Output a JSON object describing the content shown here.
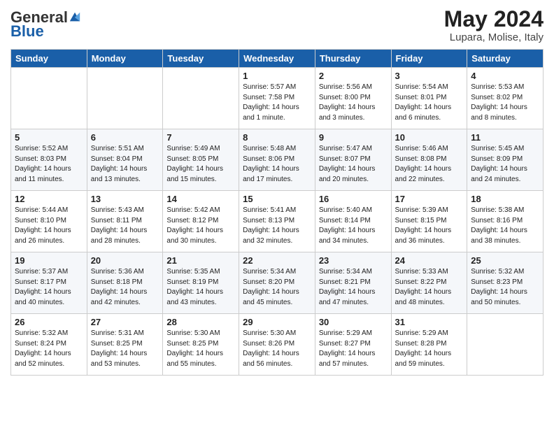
{
  "header": {
    "logo_general": "General",
    "logo_blue": "Blue",
    "month_title": "May 2024",
    "location": "Lupara, Molise, Italy"
  },
  "days_of_week": [
    "Sunday",
    "Monday",
    "Tuesday",
    "Wednesday",
    "Thursday",
    "Friday",
    "Saturday"
  ],
  "weeks": [
    [
      {
        "day": "",
        "content": ""
      },
      {
        "day": "",
        "content": ""
      },
      {
        "day": "",
        "content": ""
      },
      {
        "day": "1",
        "content": "Sunrise: 5:57 AM\nSunset: 7:58 PM\nDaylight: 14 hours\nand 1 minute."
      },
      {
        "day": "2",
        "content": "Sunrise: 5:56 AM\nSunset: 8:00 PM\nDaylight: 14 hours\nand 3 minutes."
      },
      {
        "day": "3",
        "content": "Sunrise: 5:54 AM\nSunset: 8:01 PM\nDaylight: 14 hours\nand 6 minutes."
      },
      {
        "day": "4",
        "content": "Sunrise: 5:53 AM\nSunset: 8:02 PM\nDaylight: 14 hours\nand 8 minutes."
      }
    ],
    [
      {
        "day": "5",
        "content": "Sunrise: 5:52 AM\nSunset: 8:03 PM\nDaylight: 14 hours\nand 11 minutes."
      },
      {
        "day": "6",
        "content": "Sunrise: 5:51 AM\nSunset: 8:04 PM\nDaylight: 14 hours\nand 13 minutes."
      },
      {
        "day": "7",
        "content": "Sunrise: 5:49 AM\nSunset: 8:05 PM\nDaylight: 14 hours\nand 15 minutes."
      },
      {
        "day": "8",
        "content": "Sunrise: 5:48 AM\nSunset: 8:06 PM\nDaylight: 14 hours\nand 17 minutes."
      },
      {
        "day": "9",
        "content": "Sunrise: 5:47 AM\nSunset: 8:07 PM\nDaylight: 14 hours\nand 20 minutes."
      },
      {
        "day": "10",
        "content": "Sunrise: 5:46 AM\nSunset: 8:08 PM\nDaylight: 14 hours\nand 22 minutes."
      },
      {
        "day": "11",
        "content": "Sunrise: 5:45 AM\nSunset: 8:09 PM\nDaylight: 14 hours\nand 24 minutes."
      }
    ],
    [
      {
        "day": "12",
        "content": "Sunrise: 5:44 AM\nSunset: 8:10 PM\nDaylight: 14 hours\nand 26 minutes."
      },
      {
        "day": "13",
        "content": "Sunrise: 5:43 AM\nSunset: 8:11 PM\nDaylight: 14 hours\nand 28 minutes."
      },
      {
        "day": "14",
        "content": "Sunrise: 5:42 AM\nSunset: 8:12 PM\nDaylight: 14 hours\nand 30 minutes."
      },
      {
        "day": "15",
        "content": "Sunrise: 5:41 AM\nSunset: 8:13 PM\nDaylight: 14 hours\nand 32 minutes."
      },
      {
        "day": "16",
        "content": "Sunrise: 5:40 AM\nSunset: 8:14 PM\nDaylight: 14 hours\nand 34 minutes."
      },
      {
        "day": "17",
        "content": "Sunrise: 5:39 AM\nSunset: 8:15 PM\nDaylight: 14 hours\nand 36 minutes."
      },
      {
        "day": "18",
        "content": "Sunrise: 5:38 AM\nSunset: 8:16 PM\nDaylight: 14 hours\nand 38 minutes."
      }
    ],
    [
      {
        "day": "19",
        "content": "Sunrise: 5:37 AM\nSunset: 8:17 PM\nDaylight: 14 hours\nand 40 minutes."
      },
      {
        "day": "20",
        "content": "Sunrise: 5:36 AM\nSunset: 8:18 PM\nDaylight: 14 hours\nand 42 minutes."
      },
      {
        "day": "21",
        "content": "Sunrise: 5:35 AM\nSunset: 8:19 PM\nDaylight: 14 hours\nand 43 minutes."
      },
      {
        "day": "22",
        "content": "Sunrise: 5:34 AM\nSunset: 8:20 PM\nDaylight: 14 hours\nand 45 minutes."
      },
      {
        "day": "23",
        "content": "Sunrise: 5:34 AM\nSunset: 8:21 PM\nDaylight: 14 hours\nand 47 minutes."
      },
      {
        "day": "24",
        "content": "Sunrise: 5:33 AM\nSunset: 8:22 PM\nDaylight: 14 hours\nand 48 minutes."
      },
      {
        "day": "25",
        "content": "Sunrise: 5:32 AM\nSunset: 8:23 PM\nDaylight: 14 hours\nand 50 minutes."
      }
    ],
    [
      {
        "day": "26",
        "content": "Sunrise: 5:32 AM\nSunset: 8:24 PM\nDaylight: 14 hours\nand 52 minutes."
      },
      {
        "day": "27",
        "content": "Sunrise: 5:31 AM\nSunset: 8:25 PM\nDaylight: 14 hours\nand 53 minutes."
      },
      {
        "day": "28",
        "content": "Sunrise: 5:30 AM\nSunset: 8:25 PM\nDaylight: 14 hours\nand 55 minutes."
      },
      {
        "day": "29",
        "content": "Sunrise: 5:30 AM\nSunset: 8:26 PM\nDaylight: 14 hours\nand 56 minutes."
      },
      {
        "day": "30",
        "content": "Sunrise: 5:29 AM\nSunset: 8:27 PM\nDaylight: 14 hours\nand 57 minutes."
      },
      {
        "day": "31",
        "content": "Sunrise: 5:29 AM\nSunset: 8:28 PM\nDaylight: 14 hours\nand 59 minutes."
      },
      {
        "day": "",
        "content": ""
      }
    ]
  ]
}
